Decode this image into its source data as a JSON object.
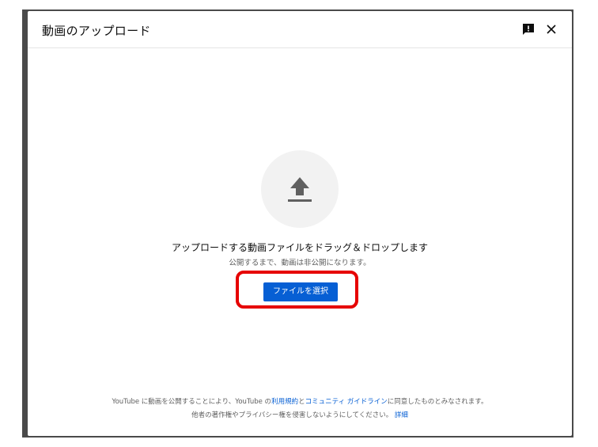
{
  "dialog": {
    "title": "動画のアップロード",
    "feedback_icon": "feedback-icon",
    "close_icon": "close-icon"
  },
  "upload": {
    "icon": "upload-icon",
    "main_text": "アップロードする動画ファイルをドラッグ＆ドロップします",
    "sub_text": "公開するまで、動画は非公開になります。",
    "select_button_label": "ファイルを選択"
  },
  "footer": {
    "line1_prefix": "YouTube に動画を公開することにより、YouTube の",
    "terms_link": "利用規約",
    "line1_mid": "と",
    "guidelines_link": "コミュニティ ガイドライン",
    "line1_suffix": "に同意したものとみなされます。",
    "line2_prefix": "他者の著作権やプライバシー権を侵害しないようにしてください。",
    "details_link": "詳細"
  },
  "colors": {
    "accent": "#065fd4",
    "highlight": "#e60000",
    "icon_circle": "#f2f2f2"
  }
}
